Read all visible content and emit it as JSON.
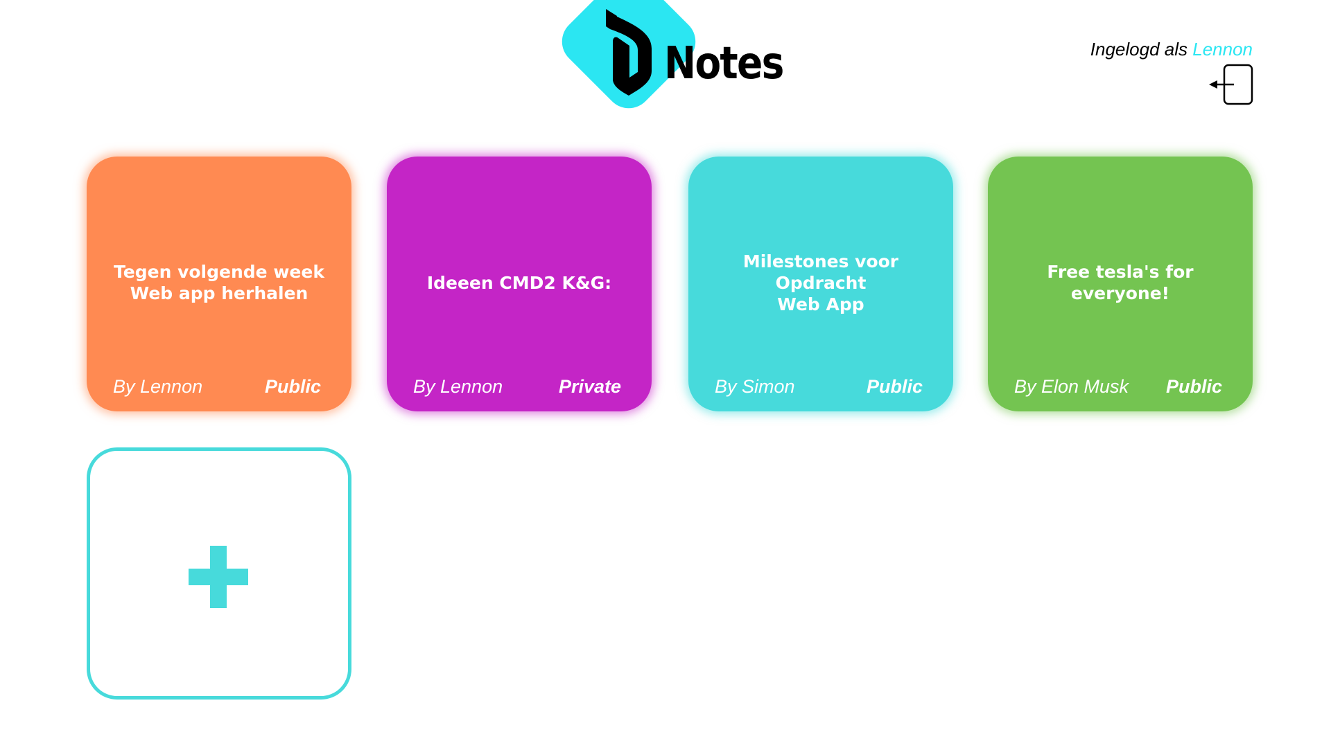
{
  "header": {
    "logo_text": "Notes",
    "logged_in_prefix": "Ingelogd als",
    "logged_in_user": "Lennon"
  },
  "notes": [
    {
      "title": "Tegen volgende week\nWeb app herhalen",
      "author": "By Lennon",
      "visibility": "Public",
      "color": "#ff8a52"
    },
    {
      "title": "Ideeen CMD2 K&G:",
      "author": "By Lennon",
      "visibility": "Private",
      "color": "#c425c6"
    },
    {
      "title": "Milestones voor Opdracht\nWeb App",
      "author": "By Simon",
      "visibility": "Public",
      "color": "#47dadb"
    },
    {
      "title": "Free tesla's for everyone!",
      "author": "By Elon Musk",
      "visibility": "Public",
      "color": "#74c451"
    }
  ],
  "icons": {
    "logo": "notes-logo-icon",
    "logout": "logout-icon",
    "add": "plus-icon"
  },
  "colors": {
    "accent": "#2be6f2",
    "add_card_border": "#47dadb"
  }
}
